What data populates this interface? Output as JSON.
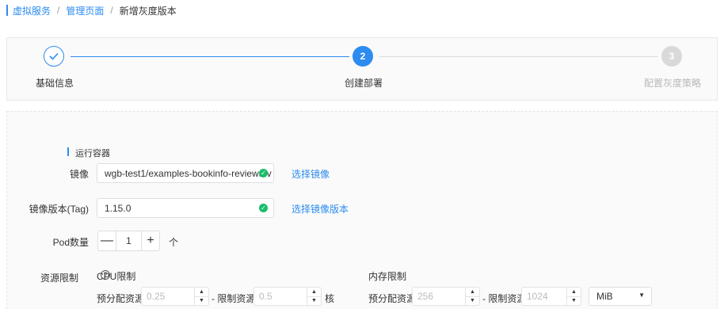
{
  "breadcrumb": {
    "items": [
      "虚拟服务",
      "管理页面"
    ],
    "current": "新增灰度版本",
    "separator": "/"
  },
  "steps": [
    {
      "label": "基础信息",
      "number": "1",
      "status": "done"
    },
    {
      "label": "创建部署",
      "number": "2",
      "status": "active"
    },
    {
      "label": "配置灰度策略",
      "number": "3",
      "status": "wait"
    }
  ],
  "form": {
    "section_title": "运行容器",
    "image": {
      "label": "镜像",
      "value": "wgb-test1/examples-bookinfo-reviews-v",
      "link": "选择镜像"
    },
    "image_tag": {
      "label": "镜像版本(Tag)",
      "value": "1.15.0",
      "link": "选择镜像版本"
    },
    "pod_count": {
      "label": "Pod数量",
      "value": "1",
      "unit": "个",
      "minus": "—",
      "plus": "+"
    },
    "resources": {
      "label": "资源限制",
      "cpu": {
        "title": "CPU限制",
        "request_label": "预分配资源",
        "request_value": "0.25",
        "limit_label": "- 限制资源",
        "limit_value": "0.5",
        "unit": "核"
      },
      "memory": {
        "title": "内存限制",
        "request_label": "预分配资源",
        "request_value": "256",
        "limit_label": "- 限制资源",
        "limit_value": "1024",
        "unit": "MiB"
      }
    }
  },
  "colors": {
    "accent": "#2d8cf0",
    "success": "#19be6b",
    "inactive": "#d9d9d9"
  }
}
